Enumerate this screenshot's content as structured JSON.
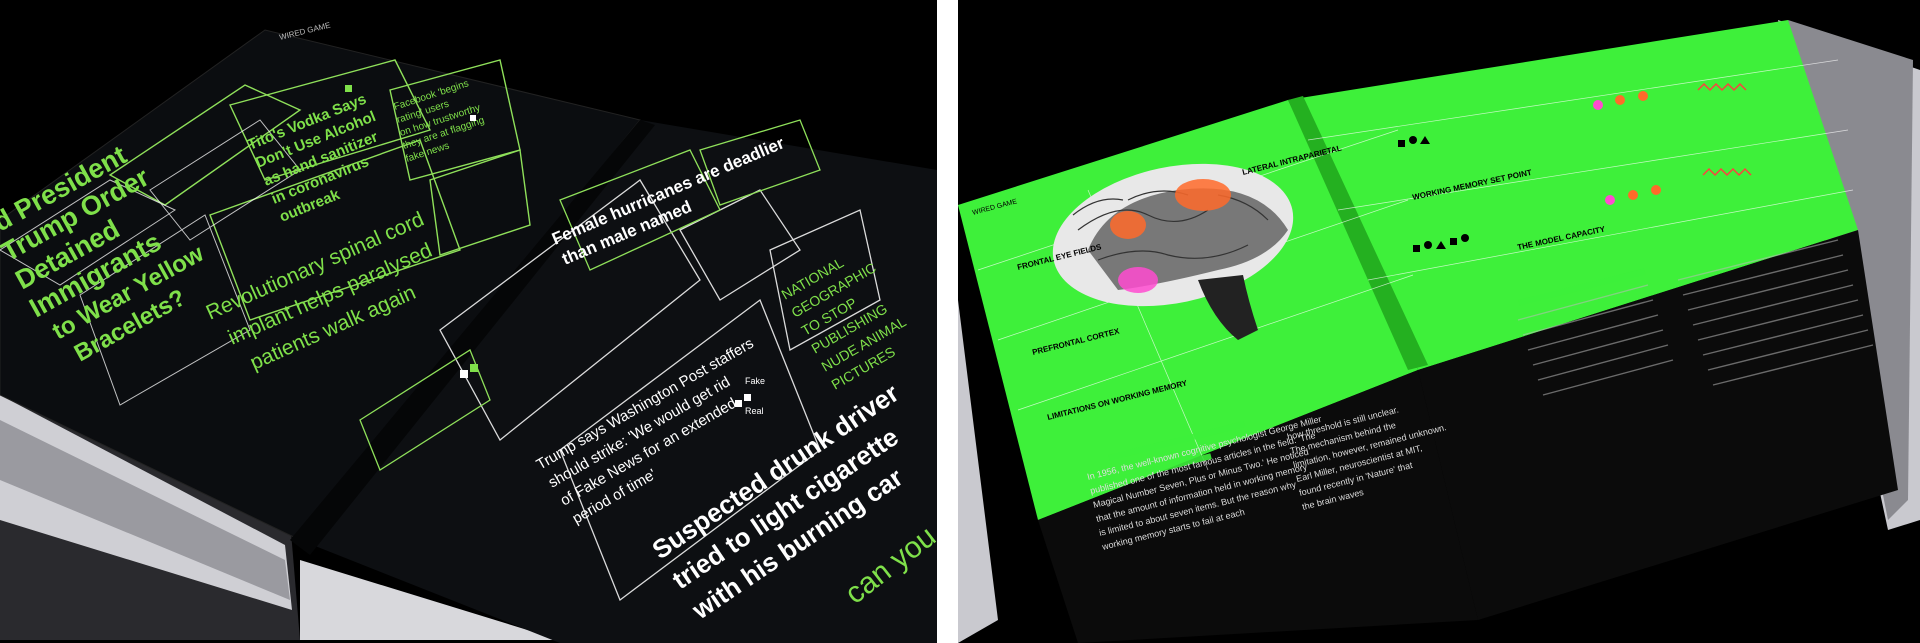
{
  "left_spread": {
    "masthead": "WIRED GAME",
    "headlines": [
      "Trump Order",
      "Detained",
      "Immigrants",
      "to Wear Yellow",
      "Bracelets?"
    ],
    "headline_prefix": "d President",
    "spinal": [
      "Revolutionary spinal cord",
      "implant helps paralysed",
      "patients walk again"
    ],
    "vodka": [
      "Tito's Vodka Says",
      "Don't Use Alcohol",
      "as hand sanitizer",
      "in coronavirus",
      "outbreak"
    ],
    "facebook": [
      "Facebook 'begins",
      "rating' users",
      "on how trustworthy",
      "they are at flagging",
      "fake news"
    ],
    "female": [
      "Female hurricanes are deadlier",
      "than male named"
    ],
    "wapo": [
      "Trump says Washington Post staffers",
      "should strike: 'We would get rid",
      "of Fake News for an extended",
      "period of time'"
    ],
    "drunk": [
      "Suspected drunk driver",
      "tried to light cigarette",
      "with his burning car"
    ],
    "natgeo": [
      "NATIONAL",
      "GEOGRAPHIC",
      "TO STOP",
      "PUBLISHING",
      "NUDE ANIMAL",
      "PICTURES"
    ],
    "options": {
      "fake": "Fake",
      "real": "Real"
    },
    "tagline": "can you spot th"
  },
  "right_spread": {
    "masthead": "WIRED GAME",
    "labels": {
      "frontal_eye": "FRONTAL EYE FIELDS",
      "prefrontal": "PREFRONTAL CORTEX",
      "lateral": "LATERAL INTRAPARIETAL",
      "limitations": "LIMITATIONS ON WORKING MEMORY",
      "working_memory": "WORKING MEMORY SET POINT",
      "model": "THE MODEL CAPACITY"
    },
    "body_lines": [
      "In 1956, the well-known cognitive psychologist George Miller",
      "published one of the most famous articles in the field: 'The",
      "Magical Number Seven, Plus or Minus Two.' He noticed",
      "that the amount of information held in working memory",
      "is limited to about seven items. But the reason why",
      "working memory starts to fail at each"
    ],
    "col2_lines": [
      "how threshold is still unclear.",
      "The mechanism behind the",
      "limitation, however, remained unknown.",
      "Earl Miller, neuroscientist at MIT,",
      "found recently in 'Nature' that",
      "the brain waves"
    ]
  }
}
